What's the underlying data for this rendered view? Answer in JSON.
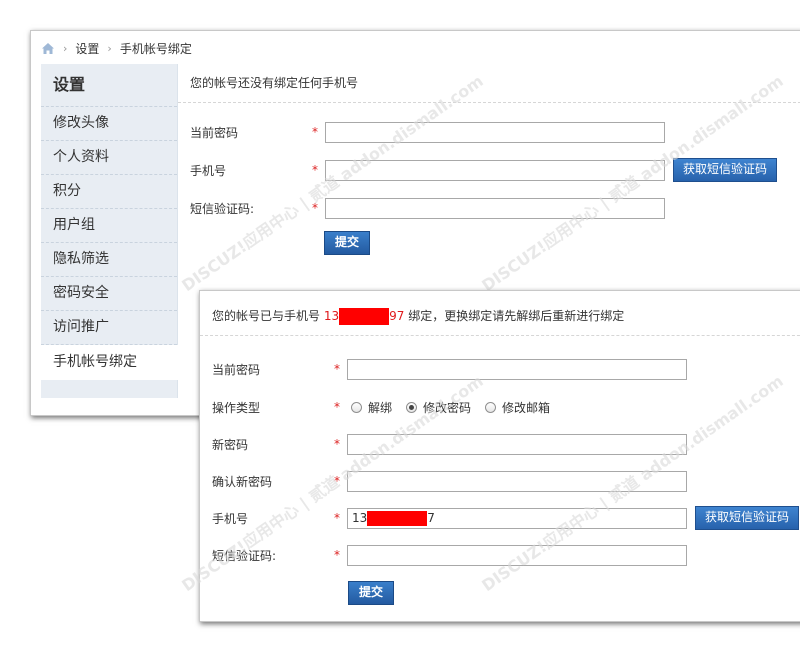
{
  "breadcrumb": {
    "items": [
      "设置",
      "手机帐号绑定"
    ]
  },
  "sidebar": {
    "title": "设置",
    "items": [
      {
        "label": "修改头像"
      },
      {
        "label": "个人资料"
      },
      {
        "label": "积分"
      },
      {
        "label": "用户组"
      },
      {
        "label": "隐私筛选"
      },
      {
        "label": "密码安全"
      },
      {
        "label": "访问推广"
      },
      {
        "label": "手机帐号绑定"
      }
    ]
  },
  "form1": {
    "notice": "您的帐号还没有绑定任何手机号",
    "current_password_label": "当前密码",
    "phone_label": "手机号",
    "sms_code_label": "短信验证码:",
    "required_mark": "*",
    "sms_button": "获取短信验证码",
    "submit": "提交"
  },
  "form2": {
    "notice_prefix": "您的帐号已与手机号 ",
    "phone_start": "13",
    "phone_end": "97",
    "notice_suffix": " 绑定，更换绑定请先解绑后重新进行绑定",
    "current_password_label": "当前密码",
    "op_type_label": "操作类型",
    "options": [
      "解绑",
      "修改密码",
      "修改邮箱"
    ],
    "selected_option": "修改密码",
    "new_password_label": "新密码",
    "confirm_password_label": "确认新密码",
    "phone_label": "手机号",
    "phone_value_start": "13",
    "phone_value_end": "7",
    "sms_code_label": "短信验证码:",
    "required_mark": "*",
    "sms_button": "获取短信验证码",
    "submit": "提交"
  },
  "colors": {
    "accent": "#2a64ad",
    "required": "#dd2222",
    "redaction": "#ff0000",
    "sidebar_bg": "#e8edf3"
  },
  "watermark": "DISCUZ!应用中心 | 贰道 addon.dismall.com"
}
